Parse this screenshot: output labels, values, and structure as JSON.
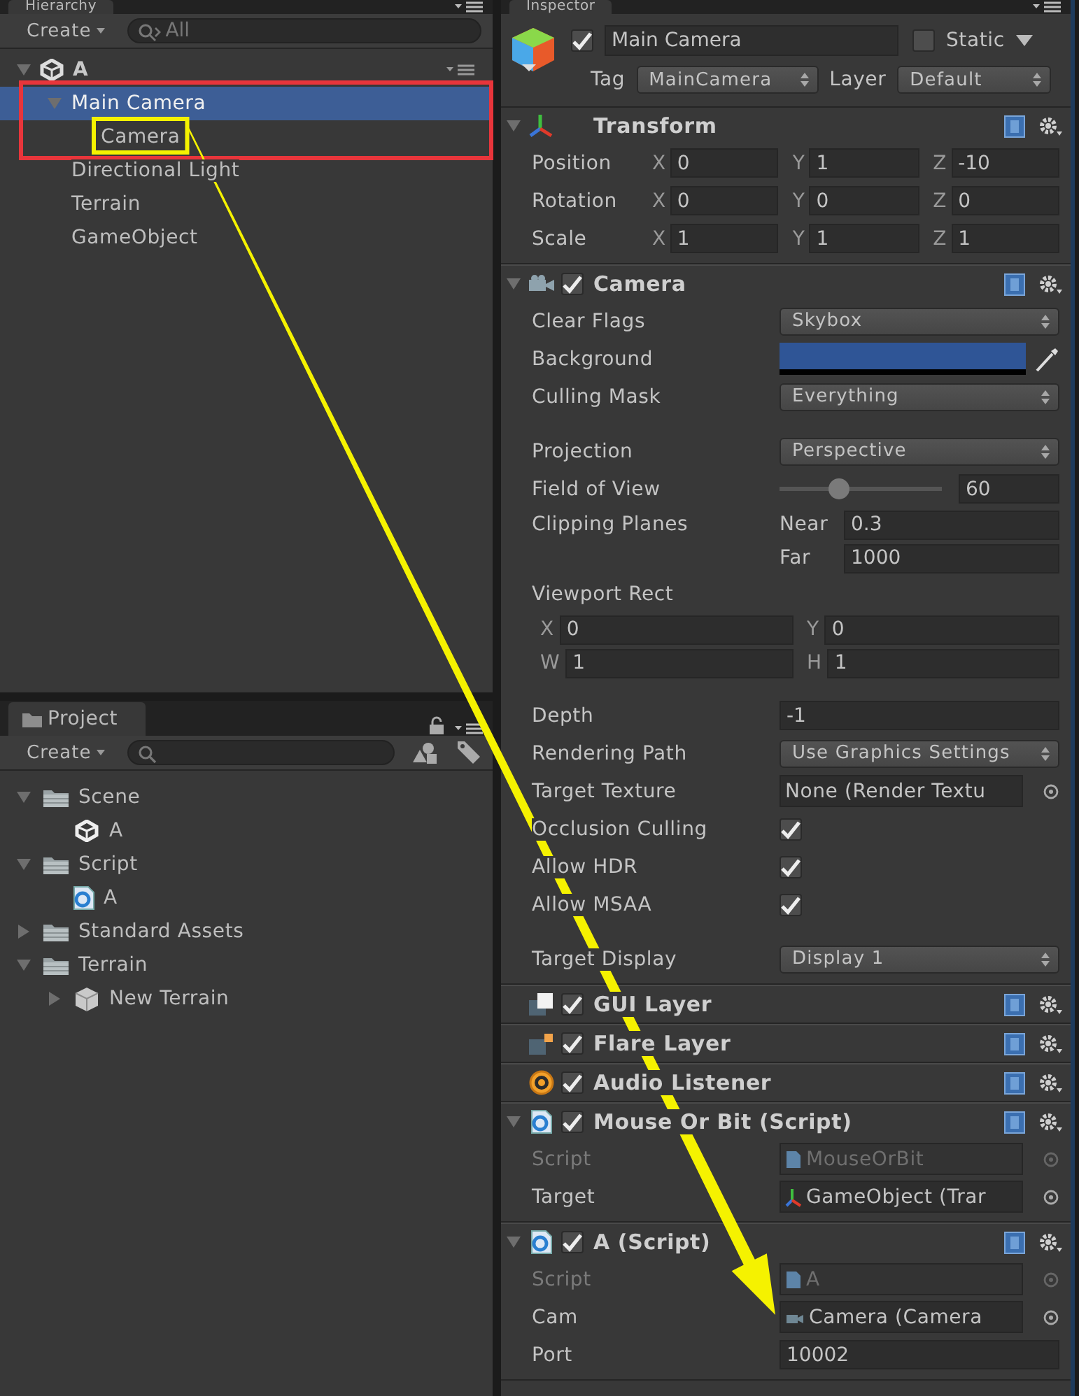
{
  "hierarchy": {
    "tab": "Hierarchy",
    "create": "Create",
    "search": {
      "placeholder": "All"
    },
    "scene": {
      "name": "A",
      "expanded": true
    },
    "items": [
      {
        "label": "Main Camera",
        "selected": true,
        "expanded": true,
        "children": [
          {
            "label": "Camera",
            "selected": false
          }
        ]
      },
      {
        "label": "Directional Light",
        "selected": false
      },
      {
        "label": "Terrain",
        "selected": false
      },
      {
        "label": "GameObject",
        "selected": false
      }
    ]
  },
  "project": {
    "tab": "Project",
    "create": "Create",
    "items": [
      {
        "label": "Scene",
        "kind": "folder",
        "expanded": true,
        "children": [
          {
            "label": "A",
            "kind": "scene"
          }
        ]
      },
      {
        "label": "Script",
        "kind": "folder",
        "expanded": true,
        "children": [
          {
            "label": "A",
            "kind": "script"
          }
        ]
      },
      {
        "label": "Standard Assets",
        "kind": "folder",
        "expanded": false
      },
      {
        "label": "Terrain",
        "kind": "folder",
        "expanded": true,
        "children": [
          {
            "label": "New Terrain",
            "kind": "prefab",
            "expanded": false
          }
        ]
      }
    ]
  },
  "inspector": {
    "tab": "Inspector",
    "object": {
      "active": true,
      "name": "Main Camera",
      "static": false,
      "static_label": "Static",
      "tag_label": "Tag",
      "tag": "MainCamera",
      "layer_label": "Layer",
      "layer": "Default"
    },
    "components": [
      {
        "title": "Transform",
        "kind": "transform",
        "expanded": true,
        "rows": [
          {
            "kind": "vec3",
            "label": "Position",
            "fields": [
              {
                "axis": "X",
                "value": "0"
              },
              {
                "axis": "Y",
                "value": "1"
              },
              {
                "axis": "Z",
                "value": "-10"
              }
            ]
          },
          {
            "kind": "vec3",
            "label": "Rotation",
            "fields": [
              {
                "axis": "X",
                "value": "0"
              },
              {
                "axis": "Y",
                "value": "0"
              },
              {
                "axis": "Z",
                "value": "0"
              }
            ]
          },
          {
            "kind": "vec3",
            "label": "Scale",
            "fields": [
              {
                "axis": "X",
                "value": "1"
              },
              {
                "axis": "Y",
                "value": "1"
              },
              {
                "axis": "Z",
                "value": "1"
              }
            ]
          }
        ]
      },
      {
        "title": "Camera",
        "kind": "camera",
        "enabled": true,
        "expanded": true,
        "rows": [
          {
            "kind": "dropdown",
            "label": "Clear Flags",
            "value": "Skybox"
          },
          {
            "kind": "color",
            "label": "Background",
            "color": "#2f5596"
          },
          {
            "kind": "dropdown",
            "label": "Culling Mask",
            "value": "Everything"
          },
          {
            "kind": "dropdown",
            "label": "Projection",
            "value": "Perspective",
            "spaced": true
          },
          {
            "kind": "slider",
            "label": "Field of View",
            "level": 0.36,
            "value": "60"
          },
          {
            "kind": "clip",
            "label": "Clipping Planes",
            "fields": [
              {
                "axis": "Near",
                "value": "0.3"
              },
              {
                "axis": "Far",
                "value": "1000"
              }
            ]
          },
          {
            "kind": "heading",
            "label": "Viewport Rect"
          },
          {
            "kind": "vec2",
            "fields": [
              {
                "axis": "X",
                "value": "0"
              },
              {
                "axis": "Y",
                "value": "0"
              }
            ]
          },
          {
            "kind": "vec2",
            "fields": [
              {
                "axis": "W",
                "value": "1"
              },
              {
                "axis": "H",
                "value": "1"
              }
            ]
          },
          {
            "kind": "text",
            "label": "Depth",
            "value": "-1",
            "spaced": true
          },
          {
            "kind": "dropdown",
            "label": "Rendering Path",
            "value": "Use Graphics Settings"
          },
          {
            "kind": "object",
            "label": "Target Texture",
            "value": "None (Render Textu",
            "disabled": false
          },
          {
            "kind": "check",
            "label": "Occlusion Culling",
            "checked": true
          },
          {
            "kind": "check",
            "label": "Allow HDR",
            "checked": true
          },
          {
            "kind": "check",
            "label": "Allow MSAA",
            "checked": true
          },
          {
            "kind": "dropdown",
            "label": "Target Display",
            "value": "Display 1",
            "spaced": true
          }
        ]
      },
      {
        "title": "GUI Layer",
        "kind": "gui_layer",
        "enabled": true
      },
      {
        "title": "Flare Layer",
        "kind": "flare_layer",
        "enabled": true
      },
      {
        "title": "Audio Listener",
        "kind": "audio_listener",
        "enabled": true
      },
      {
        "title": "Mouse Or Bit (Script)",
        "kind": "script",
        "enabled": true,
        "expanded": true,
        "rows": [
          {
            "kind": "object_script",
            "label": "Script",
            "value": "MouseOrBit",
            "disabled": true
          },
          {
            "kind": "object_transform",
            "label": "Target",
            "value": "GameObject (Trar",
            "disabled": false
          }
        ]
      },
      {
        "title": "A (Script)",
        "kind": "script",
        "enabled": true,
        "expanded": true,
        "rows": [
          {
            "kind": "object_script",
            "label": "Script",
            "value": "A",
            "disabled": true
          },
          {
            "kind": "object_camera",
            "label": "Cam",
            "value": "Camera (Camera",
            "disabled": false
          },
          {
            "kind": "text",
            "label": "Port",
            "value": "10002"
          }
        ]
      }
    ]
  },
  "annotations": [
    {
      "kind": "frame",
      "color": "#e8353b"
    },
    {
      "kind": "frame",
      "color": "#f5f200"
    },
    {
      "kind": "arrow",
      "color": "#f5f200"
    }
  ]
}
